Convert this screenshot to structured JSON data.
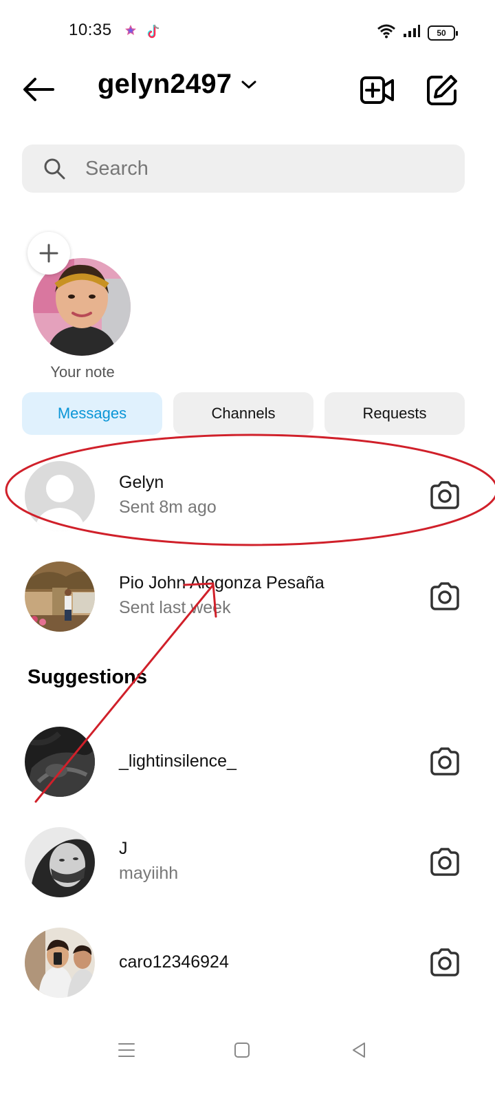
{
  "status_bar": {
    "time": "10:35",
    "battery": "50"
  },
  "header": {
    "account_name": "gelyn2497"
  },
  "search": {
    "placeholder": "Search"
  },
  "note": {
    "label": "Your note"
  },
  "tabs": [
    {
      "label": "Messages",
      "active": true
    },
    {
      "label": "Channels",
      "active": false
    },
    {
      "label": "Requests",
      "active": false
    }
  ],
  "conversations": [
    {
      "name": "Gelyn",
      "status": "Sent 8m ago"
    },
    {
      "name": "Pio John Alegonza Pesaña",
      "status": "Sent last week"
    }
  ],
  "suggestions": {
    "title": "Suggestions",
    "items": [
      {
        "name": "_lightinsilence_",
        "subtitle": ""
      },
      {
        "name": "J",
        "subtitle": "mayiihh"
      },
      {
        "name": "caro12346924",
        "subtitle": ""
      }
    ]
  },
  "colors": {
    "accent_blue": "#0a95d6",
    "active_tab_bg": "#e0f1fd",
    "annotation_red": "#d0202a"
  }
}
